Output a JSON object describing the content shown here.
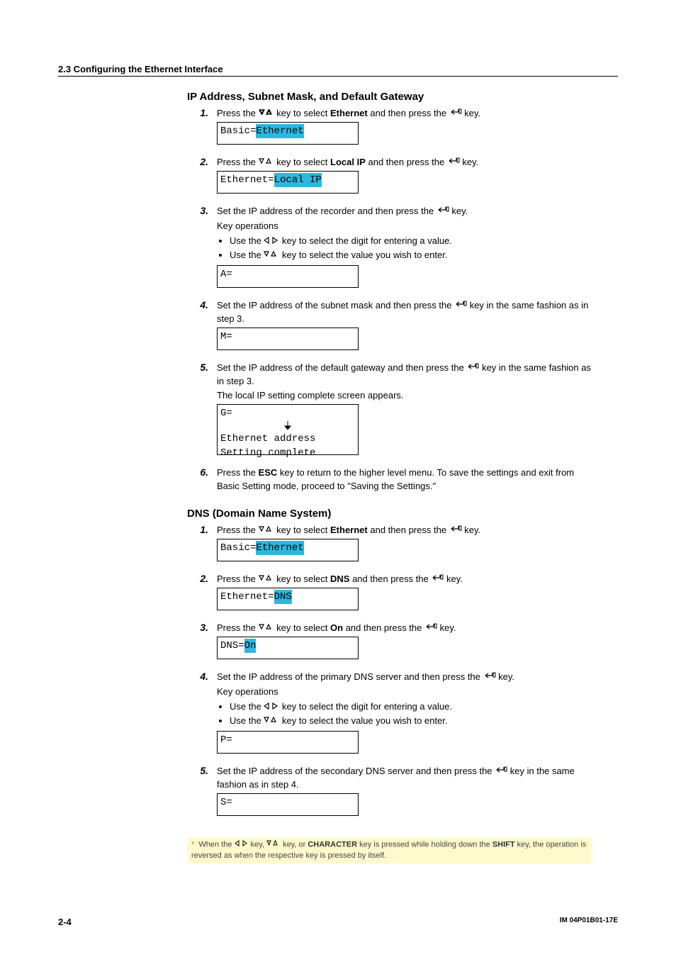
{
  "header": {
    "section": "2.3  Configuring the Ethernet Interface"
  },
  "section_ip": {
    "title": "IP Address, Subnet Mask, and Default Gateway",
    "steps": [
      {
        "num": "1.",
        "pre": "Press the ",
        "mid": " key to select ",
        "target": "Ethernet",
        "post": " and then press the ",
        "tail": " key.",
        "lcd_prefix": "Basic=",
        "lcd_hl": "Ethernet"
      },
      {
        "num": "2.",
        "pre": "Press the ",
        "mid": " key to select ",
        "target": "Local IP",
        "post": " and then press the ",
        "tail": " key.",
        "lcd_prefix": "Ethernet=",
        "lcd_hl": "Local IP"
      },
      {
        "num": "3.",
        "line1": "Set the IP address of the recorder and then press the ",
        "line1_tail": " key.",
        "keyops_title": "Key operations",
        "bullet1_pre": "Use the ",
        "bullet1_post": " key to select the digit for entering a value.",
        "bullet2_pre": "Use the ",
        "bullet2_post": " key to select the value you wish to enter.",
        "lcd_prefix": "A=",
        "lcd_hl": " "
      },
      {
        "num": "4.",
        "text": "Set the IP address of the subnet mask and then press the ",
        "text_tail": " key in the same fashion as in step 3.",
        "lcd_prefix": "M=",
        "lcd_hl": " "
      },
      {
        "num": "5.",
        "text": "Set the IP address of the default gateway and then press the ",
        "text_tail": " key in the same fashion as in step 3.",
        "line2": "The local IP setting complete screen appears.",
        "lcd_prefix": "G=",
        "lcd_hl": " ",
        "lcd_extra1": "Ethernet address",
        "lcd_extra2": "Setting complete"
      },
      {
        "num": "6.",
        "text_pre": "Press the ",
        "text_key": "ESC",
        "text_post": " key to return to the higher level menu. To save the settings and exit from Basic Setting mode, proceed to \"Saving the Settings.\""
      }
    ]
  },
  "section_dns": {
    "title": "DNS (Domain Name System)",
    "steps": [
      {
        "num": "1.",
        "pre": "Press the ",
        "mid": " key to select ",
        "target": "Ethernet",
        "post": " and then press the ",
        "tail": " key.",
        "lcd_prefix": "Basic=",
        "lcd_hl": "Ethernet"
      },
      {
        "num": "2.",
        "pre": "Press the ",
        "mid": " key to select ",
        "target": "DNS",
        "post": " and then press the ",
        "tail": " key.",
        "lcd_prefix": "Ethernet=",
        "lcd_hl": "DNS"
      },
      {
        "num": "3.",
        "pre": "Press the ",
        "mid": " key to select ",
        "target": "On",
        "post": " and then press the ",
        "tail": " key.",
        "lcd_prefix": "DNS=",
        "lcd_hl": "On"
      },
      {
        "num": "4.",
        "line1": "Set the IP address of the primary DNS server and then press the ",
        "line1_tail": " key.",
        "keyops_title": "Key operations",
        "bullet1_pre": "Use the ",
        "bullet1_post": " key to select the digit for entering a value.",
        "bullet2_pre": "Use the ",
        "bullet2_post": " key to select the value you wish to enter.",
        "lcd_prefix": "P=",
        "lcd_hl": " "
      },
      {
        "num": "5.",
        "text": "Set the IP address of the secondary DNS server and then press the ",
        "text_tail": " key in the same fashion as in step 4.",
        "lcd_prefix": "S=",
        "lcd_hl": " "
      }
    ]
  },
  "footnote": {
    "star": "*",
    "pre": "When the ",
    "mid1": " key, ",
    "mid2": " key, or ",
    "char_key": "CHARACTER",
    "mid3": " key is pressed while holding down the ",
    "shift_key": "SHIFT",
    "post": " key, the operation is reversed as when the respective key is pressed by itself."
  },
  "footer": {
    "page": "2-4",
    "doc": "IM 04P01B01-17E"
  }
}
